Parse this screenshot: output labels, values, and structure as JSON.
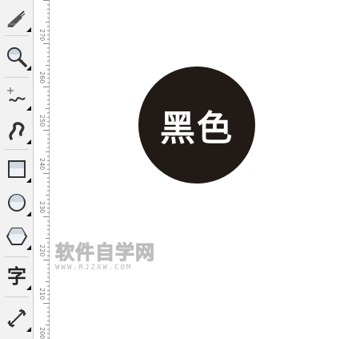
{
  "toolbox": {
    "tools": [
      {
        "name": "artistic-media-tool",
        "icon": "artistic-media-icon",
        "flyout": true
      },
      {
        "name": "zoom-tool",
        "icon": "magnifier-icon",
        "flyout": true
      },
      {
        "name": "freehand-tool",
        "icon": "freehand-curve-icon",
        "flyout": true
      },
      {
        "name": "smart-fill-tool",
        "icon": "smart-drawing-icon",
        "flyout": true
      },
      {
        "name": "rectangle-tool",
        "icon": "rectangle-icon",
        "flyout": true
      },
      {
        "name": "ellipse-tool",
        "icon": "ellipse-icon",
        "flyout": true
      },
      {
        "name": "polygon-tool",
        "icon": "hexagon-icon",
        "flyout": true
      },
      {
        "name": "text-tool",
        "icon": "text-icon",
        "glyph": "字",
        "flyout": true
      },
      {
        "name": "dimension-tool",
        "icon": "parallel-dimension-icon",
        "flyout": true
      }
    ]
  },
  "ruler": {
    "labels": [
      "270",
      "260",
      "250",
      "240",
      "230",
      "220",
      "210",
      "200"
    ]
  },
  "canvas": {
    "circle_text": "黑色",
    "circle_color": "#211a16",
    "text_color": "#ffffff"
  },
  "watermark": {
    "main": "软件自学网",
    "sub": "WWW.RJZXW.COM"
  }
}
